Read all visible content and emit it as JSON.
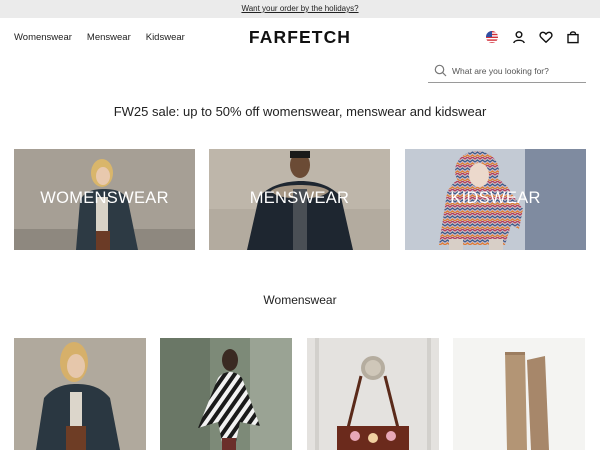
{
  "promo": {
    "text": "Want your order by the holidays?"
  },
  "header": {
    "nav": [
      "Womenswear",
      "Menswear",
      "Kidswear"
    ],
    "logo": "FARFETCH",
    "icons": [
      "us-flag-icon",
      "account-icon",
      "wishlist-heart-icon",
      "bag-icon"
    ]
  },
  "search": {
    "placeholder": "What are you looking for?",
    "value": ""
  },
  "headline": "FW25 sale: up to 50% off womenswear, menswear and kidswear",
  "categories": [
    {
      "label": "WOMENSWEAR"
    },
    {
      "label": "MENSWEAR"
    },
    {
      "label": "KIDSWEAR"
    }
  ],
  "section": {
    "title": "Womenswear"
  },
  "products": [
    {
      "name": "product-coat-woman"
    },
    {
      "name": "product-striped-poncho"
    },
    {
      "name": "product-embroidered-bag"
    },
    {
      "name": "product-suede-boots"
    }
  ],
  "colors": {
    "promo_bg": "#ebebeb",
    "text": "#222222",
    "logo": "#111111"
  }
}
